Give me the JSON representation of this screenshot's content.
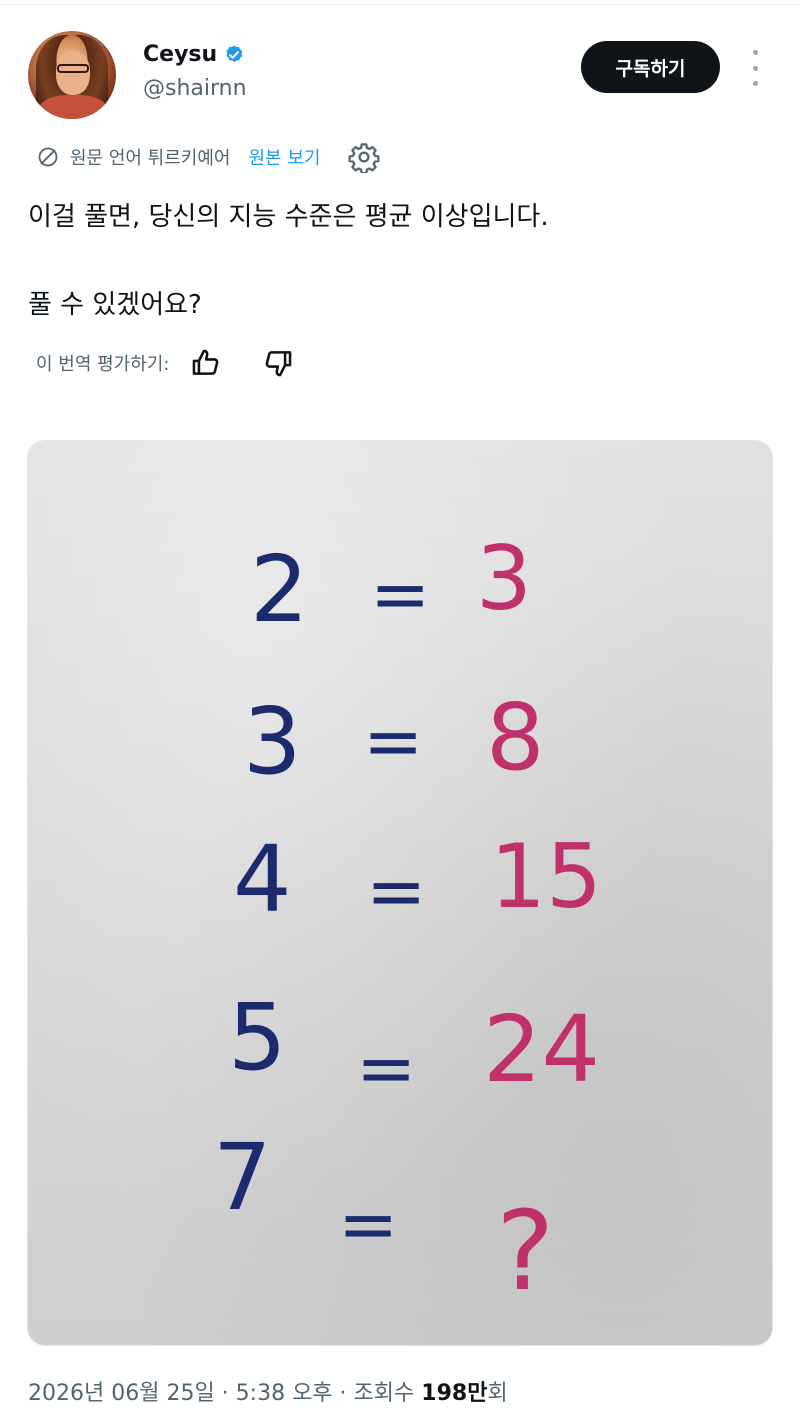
{
  "author": {
    "display_name": "Ceysu",
    "handle": "@shairnn",
    "verified": true
  },
  "actions": {
    "subscribe_label": "구독하기"
  },
  "translation": {
    "note": "원문 언어 튀르키예어",
    "show_original": "원본 보기"
  },
  "tweet": {
    "line1": "이걸 풀면, 당신의 지능 수준은 평균 이상입니다.",
    "line2": "풀 수 있겠어요?"
  },
  "rate": {
    "label": "이 번역 평가하기:"
  },
  "puzzle": {
    "rows": [
      {
        "left": "2",
        "eq": "=",
        "right": "3"
      },
      {
        "left": "3",
        "eq": "=",
        "right": "8"
      },
      {
        "left": "4",
        "eq": "=",
        "right": "15"
      },
      {
        "left": "5",
        "eq": "=",
        "right": "24"
      },
      {
        "left": "7",
        "eq": "=",
        "right": "?"
      }
    ]
  },
  "meta": {
    "date": "2026년 06월 25일",
    "sep1": " · ",
    "time": "5:38 오후",
    "sep2": " · ",
    "views_label": "조회수 ",
    "views_count": "198만",
    "views_suffix": "회"
  },
  "colors": {
    "accent": "#1d9bf0",
    "ink_blue": "#1c2a6e",
    "ink_pink": "#c0306a",
    "button_bg": "#0f1419",
    "muted": "#536471"
  }
}
